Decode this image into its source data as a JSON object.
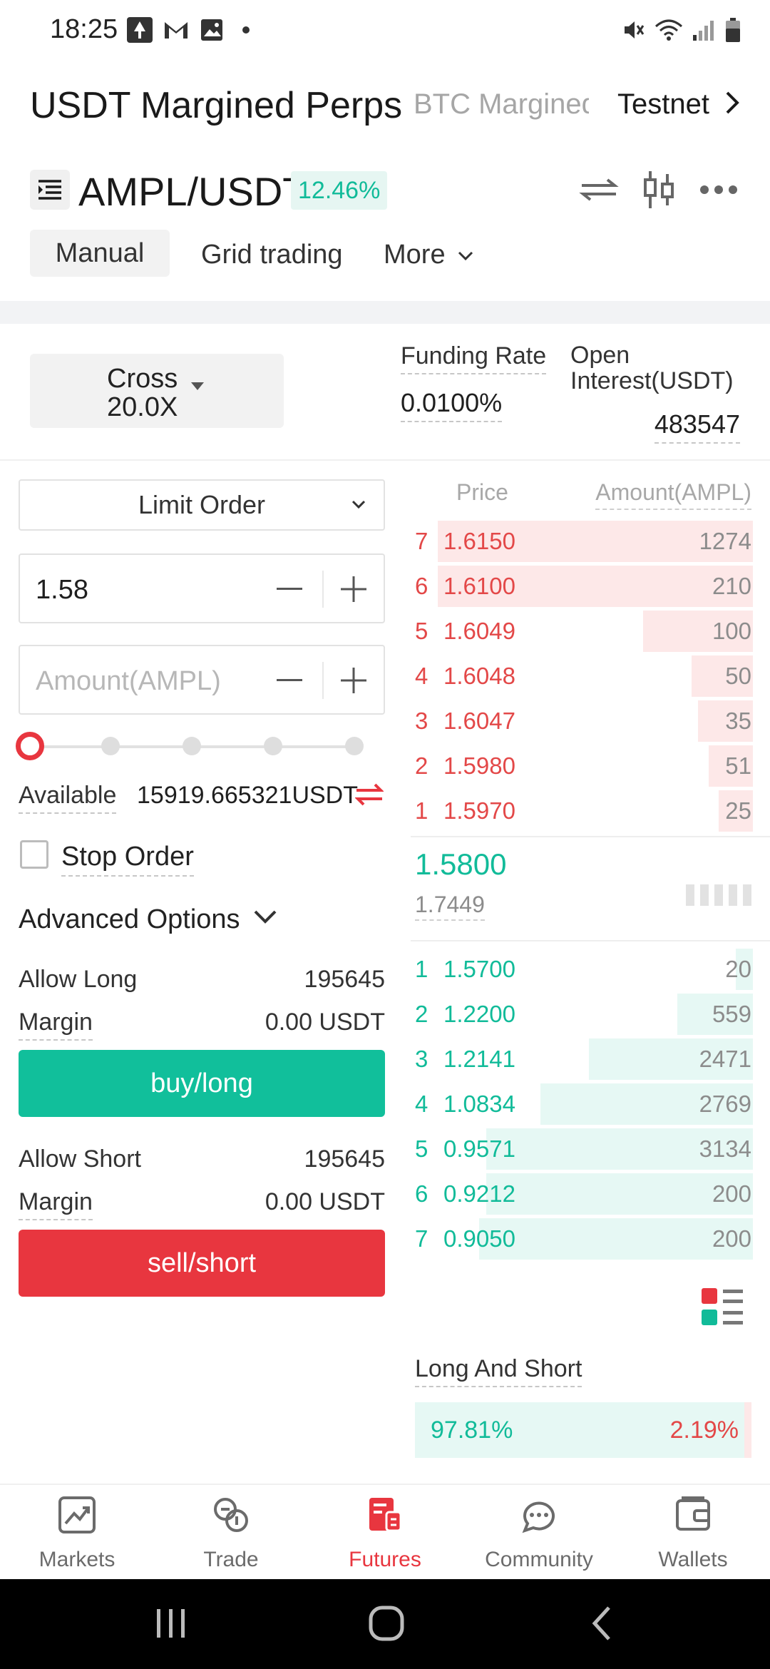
{
  "status_bar": {
    "time": "18:25"
  },
  "header": {
    "tabs": [
      {
        "label": "USDT Margined Perps"
      },
      {
        "label": "BTC Margined"
      },
      {
        "label": "Testnet"
      }
    ]
  },
  "pair": {
    "name": "AMPL/USDT",
    "change": "12.46%"
  },
  "modes": {
    "manual": "Manual",
    "grid": "Grid trading",
    "more": "More"
  },
  "leverage": {
    "mode": "Cross",
    "value": "20.0X"
  },
  "funding": {
    "label": "Funding Rate",
    "value": "0.0100%"
  },
  "open_interest": {
    "label": "Open Interest(USDT)",
    "value": "483547"
  },
  "order_form": {
    "order_type": "Limit Order",
    "price_value": "1.58",
    "amount_placeholder": "Amount(AMPL)",
    "available_label": "Available",
    "available_value": "15919.665321USDT",
    "stop_order_label": "Stop Order",
    "advanced_label": "Advanced Options",
    "allow_long_label": "Allow Long",
    "allow_long_value": "195645",
    "margin_label": "Margin",
    "margin_long_value": "0.00 USDT",
    "buy_label": "buy/long",
    "allow_short_label": "Allow Short",
    "allow_short_value": "195645",
    "margin_short_value": "0.00 USDT",
    "sell_label": "sell/short",
    "slider_percent": 0
  },
  "order_book": {
    "price_header": "Price",
    "amount_header": "Amount(AMPL)",
    "asks": [
      {
        "idx": "7",
        "price": "1.6150",
        "amount": "1274",
        "depth": 0.92
      },
      {
        "idx": "6",
        "price": "1.6100",
        "amount": "210",
        "depth": 0.92
      },
      {
        "idx": "5",
        "price": "1.6049",
        "amount": "100",
        "depth": 0.32
      },
      {
        "idx": "4",
        "price": "1.6048",
        "amount": "50",
        "depth": 0.18
      },
      {
        "idx": "3",
        "price": "1.6047",
        "amount": "35",
        "depth": 0.16
      },
      {
        "idx": "2",
        "price": "1.5980",
        "amount": "51",
        "depth": 0.13
      },
      {
        "idx": "1",
        "price": "1.5970",
        "amount": "25",
        "depth": 0.1
      }
    ],
    "last_price": "1.5800",
    "mark_price": "1.7449",
    "bids": [
      {
        "idx": "1",
        "price": "1.5700",
        "amount": "20",
        "depth": 0.05
      },
      {
        "idx": "2",
        "price": "1.2200",
        "amount": "559",
        "depth": 0.22
      },
      {
        "idx": "3",
        "price": "1.2141",
        "amount": "2471",
        "depth": 0.48
      },
      {
        "idx": "4",
        "price": "1.0834",
        "amount": "2769",
        "depth": 0.62
      },
      {
        "idx": "5",
        "price": "0.9571",
        "amount": "3134",
        "depth": 0.78
      },
      {
        "idx": "6",
        "price": "0.9212",
        "amount": "200",
        "depth": 0.78
      },
      {
        "idx": "7",
        "price": "0.9050",
        "amount": "200",
        "depth": 0.8
      }
    ]
  },
  "long_short": {
    "label": "Long And Short",
    "long": "97.81%",
    "short": "2.19%",
    "long_fraction": 0.9781
  },
  "bottom_nav": {
    "items": [
      {
        "label": "Markets",
        "icon": "markets-icon"
      },
      {
        "label": "Trade",
        "icon": "trade-icon"
      },
      {
        "label": "Futures",
        "icon": "futures-icon"
      },
      {
        "label": "Community",
        "icon": "community-icon"
      },
      {
        "label": "Wallets",
        "icon": "wallets-icon"
      }
    ],
    "active": "Futures"
  },
  "colors": {
    "green": "#11bb99",
    "red": "#e8363f"
  }
}
